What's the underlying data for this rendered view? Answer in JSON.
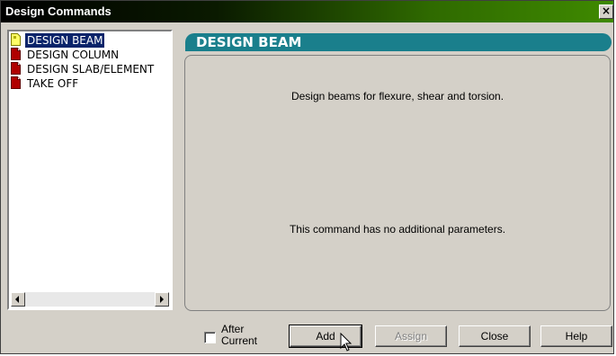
{
  "window": {
    "title": "Design Commands",
    "close_glyph": "×"
  },
  "command_list": {
    "items": [
      {
        "label": "DESIGN BEAM",
        "selected": true,
        "icon": "document-icon"
      },
      {
        "label": "DESIGN COLUMN",
        "selected": false,
        "icon": "document-icon"
      },
      {
        "label": "DESIGN SLAB/ELEMENT",
        "selected": false,
        "icon": "document-icon"
      },
      {
        "label": "TAKE OFF",
        "selected": false,
        "icon": "document-icon"
      }
    ]
  },
  "detail": {
    "header": "DESIGN BEAM",
    "description": "Design beams for flexure, shear and torsion.",
    "parameters_note": "This command has no additional parameters."
  },
  "footer": {
    "after_current_line1": "After",
    "after_current_line2": "Current",
    "after_current_checked": false,
    "add_label": "Add",
    "assign_label": "Assign",
    "close_label": "Close",
    "help_label": "Help"
  },
  "colors": {
    "header_teal": "#1a7f8c",
    "selection": "#0a246a",
    "face": "#d4d0c8"
  }
}
